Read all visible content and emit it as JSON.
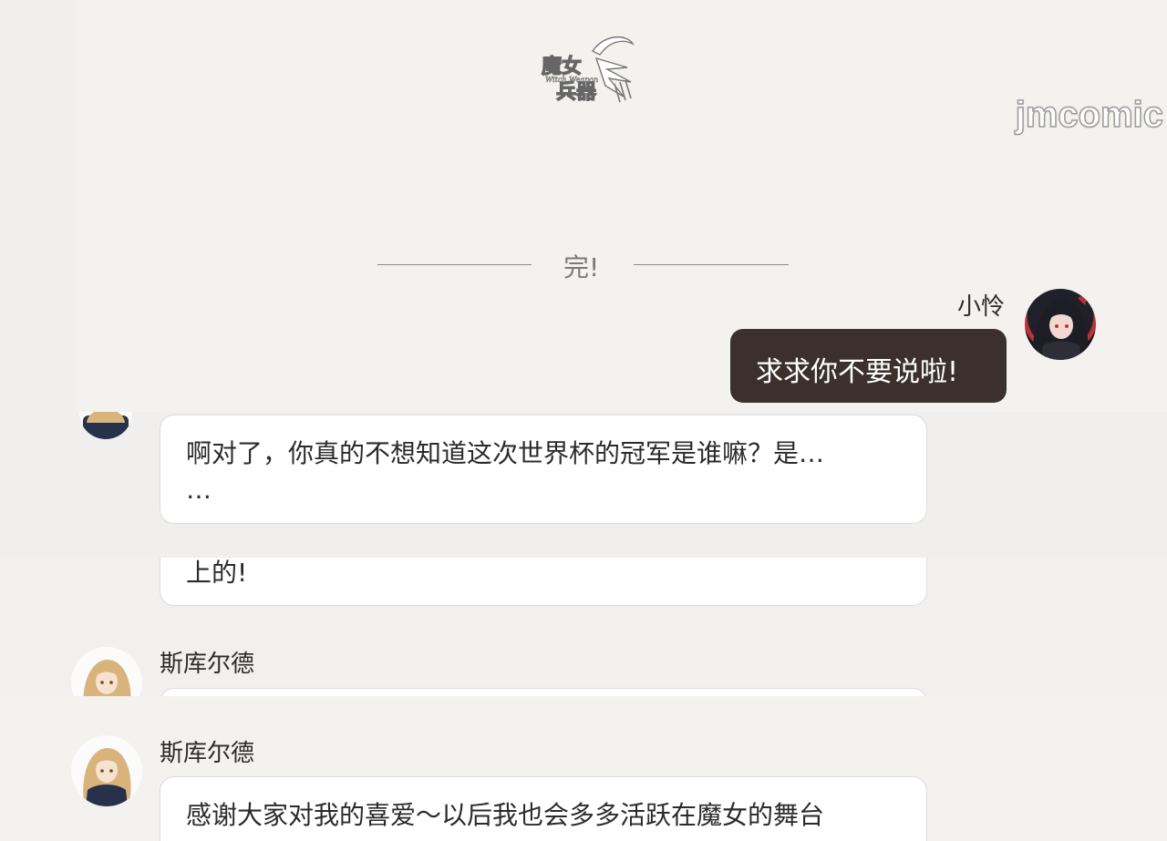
{
  "logo": {
    "text_line1": "魔女",
    "text_line2": "兵器",
    "subtitle": "Witch Weapon"
  },
  "watermark": "jmcomic",
  "end_marker": "完!",
  "messages": [
    {
      "speaker": "小怜",
      "text": "求求你不要说啦!"
    },
    {
      "text_line1": "啊对了，你真的不想知道这次世界杯的冠军是谁嘛？是…",
      "text_line2": "…"
    },
    {
      "text": "上的!"
    },
    {
      "speaker": "斯库尔德"
    },
    {
      "speaker": "斯库尔德",
      "text": "感谢大家对我的喜爱～以后我也会多多活跃在魔女的舞台"
    }
  ],
  "colors": {
    "page_bg": "#f1efeb",
    "dark_bubble": "#3b302d",
    "bubble_bg": "#ffffff",
    "rule": "#8a8a8a"
  }
}
